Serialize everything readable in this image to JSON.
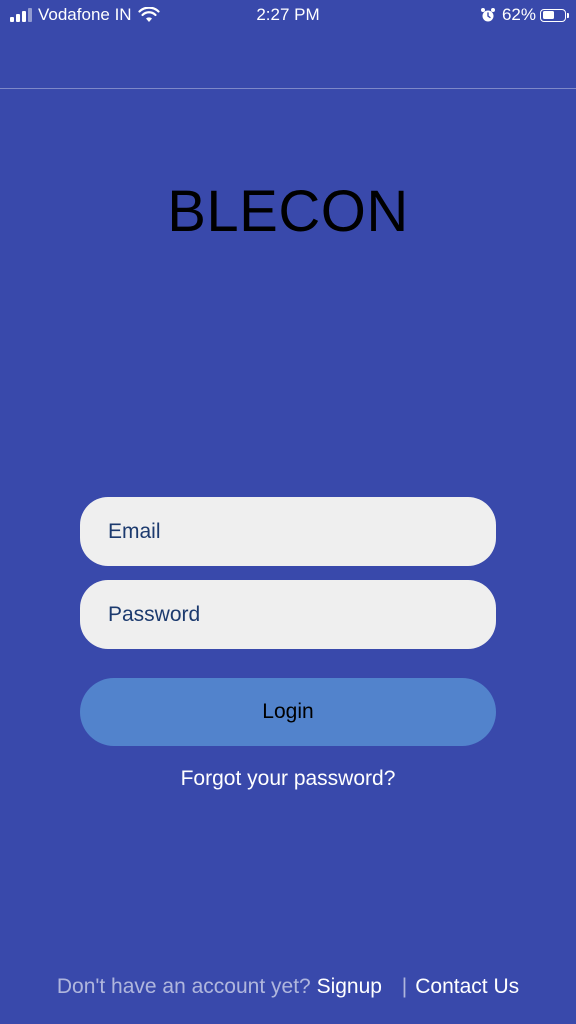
{
  "status_bar": {
    "carrier": "Vodafone IN",
    "time": "2:27 PM",
    "battery_percent": "62%",
    "battery_level": 0.62,
    "icons": [
      "signal-icon",
      "wifi-icon",
      "alarm-icon",
      "battery-icon"
    ]
  },
  "app": {
    "logo_text": "BLECON"
  },
  "form": {
    "email_placeholder": "Email",
    "password_placeholder": "Password",
    "login_label": "Login",
    "forgot_label": "Forgot your password?"
  },
  "footer": {
    "prompt": "Don't have an account yet?",
    "signup_label": "Signup",
    "separator": "|",
    "contact_label": "Contact Us"
  },
  "colors": {
    "background": "#3949ab",
    "input_background": "#efefef",
    "input_text": "#1c3a6e",
    "button_background": "#5283cc",
    "logo_text": "#000000"
  }
}
